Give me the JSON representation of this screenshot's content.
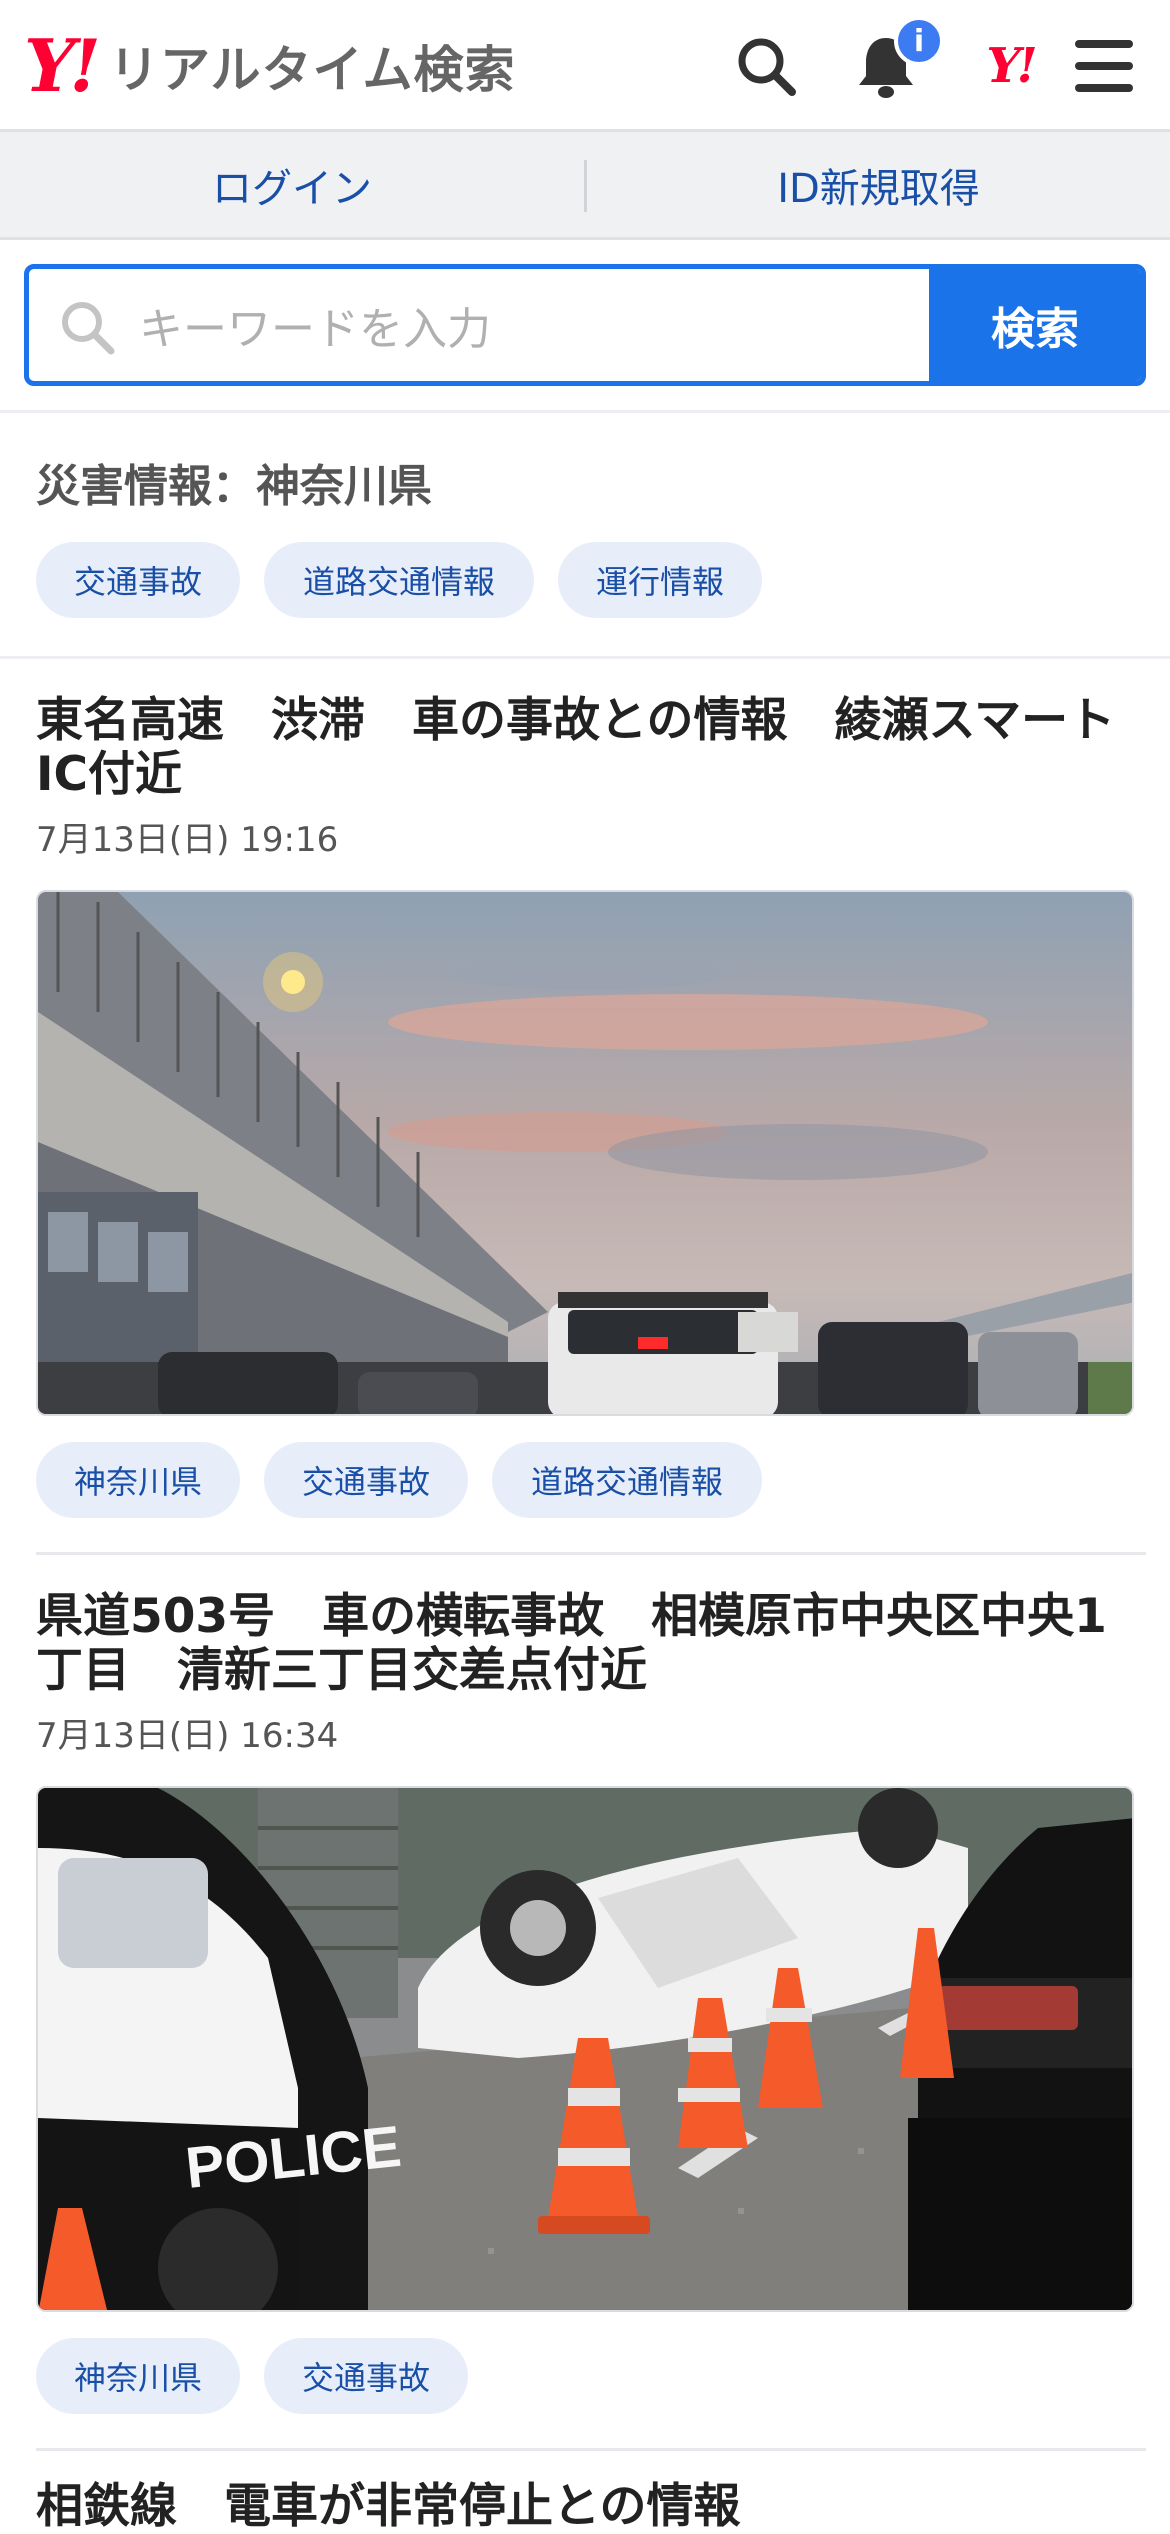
{
  "header": {
    "logo_mark": "Y!",
    "logo_text": "リアルタイム検索",
    "notification_badge": "i",
    "yahoo_mark": "Y!"
  },
  "account": {
    "login": "ログイン",
    "signup": "ID新規取得"
  },
  "search": {
    "placeholder": "キーワードを入力",
    "button": "検索"
  },
  "disaster": {
    "title": "災害情報：神奈川県",
    "tags": [
      "交通事故",
      "道路交通情報",
      "運行情報"
    ]
  },
  "articles": [
    {
      "title": "東名高速　渋滞　車の事故との情報　綾瀬スマートIC付近",
      "date": "7月13日(日) 19:16",
      "tags": [
        "神奈川県",
        "交通事故",
        "道路交通情報"
      ]
    },
    {
      "title": "県道503号　車の横転事故　相模原市中央区中央1丁目　清新三丁目交差点付近",
      "date": "7月13日(日) 16:34",
      "tags": [
        "神奈川県",
        "交通事故"
      ],
      "photo_text": "POLICE"
    },
    {
      "title": "相鉄線　電車が非常停止との情報"
    }
  ],
  "colors": {
    "brand": "#ff0033",
    "accent": "#1a73e8",
    "chip_bg": "#e8eef9",
    "chip_text": "#1a4fa8"
  }
}
